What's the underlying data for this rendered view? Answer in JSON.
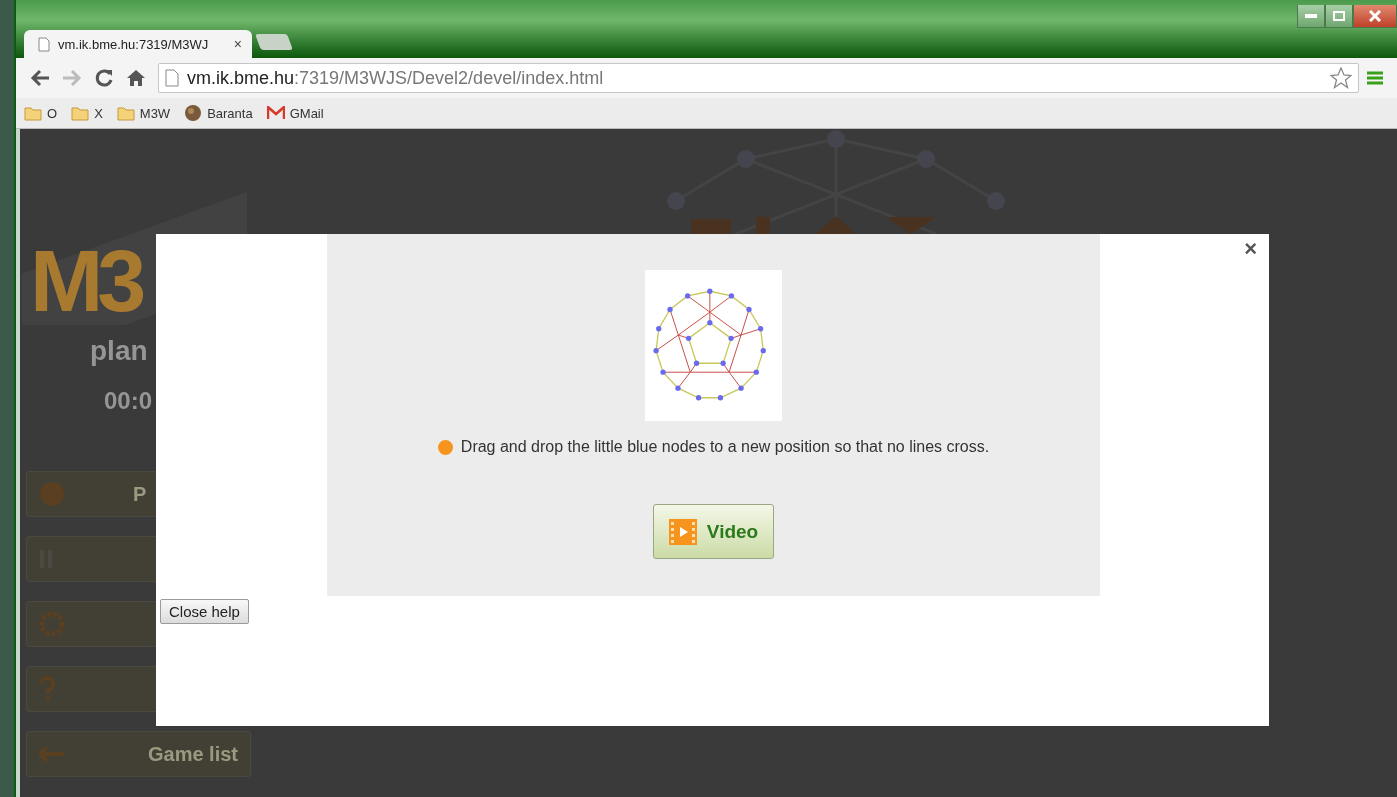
{
  "tabs": [
    {
      "label": "vm.ik.bme.hu:7319/M3WJ",
      "close": "×",
      "selected": true
    },
    {
      "kind": "new"
    }
  ],
  "address": {
    "host": "vm.ik.bme.hu",
    "path": ":7319/M3WJS/Devel2/devel/index.html"
  },
  "bookmarks": [
    {
      "label": "O",
      "kind": "folder"
    },
    {
      "label": "X",
      "kind": "folder"
    },
    {
      "label": "M3W",
      "kind": "folder"
    },
    {
      "label": "Baranta",
      "kind": "site"
    },
    {
      "label": "GMail",
      "kind": "mail"
    }
  ],
  "sidebar": {
    "logo": "M3",
    "title": "plan",
    "timer": "00:0",
    "buttons": [
      {
        "kind": "play",
        "label": "P"
      },
      {
        "kind": "pause"
      },
      {
        "kind": "settings"
      },
      {
        "kind": "help"
      },
      {
        "kind": "back",
        "label": "Game list"
      }
    ]
  },
  "dialog": {
    "close": "×",
    "hint": "Drag and drop the little blue nodes to a new position so that no lines cross.",
    "video_button": "Video",
    "close_button": "Close help"
  }
}
